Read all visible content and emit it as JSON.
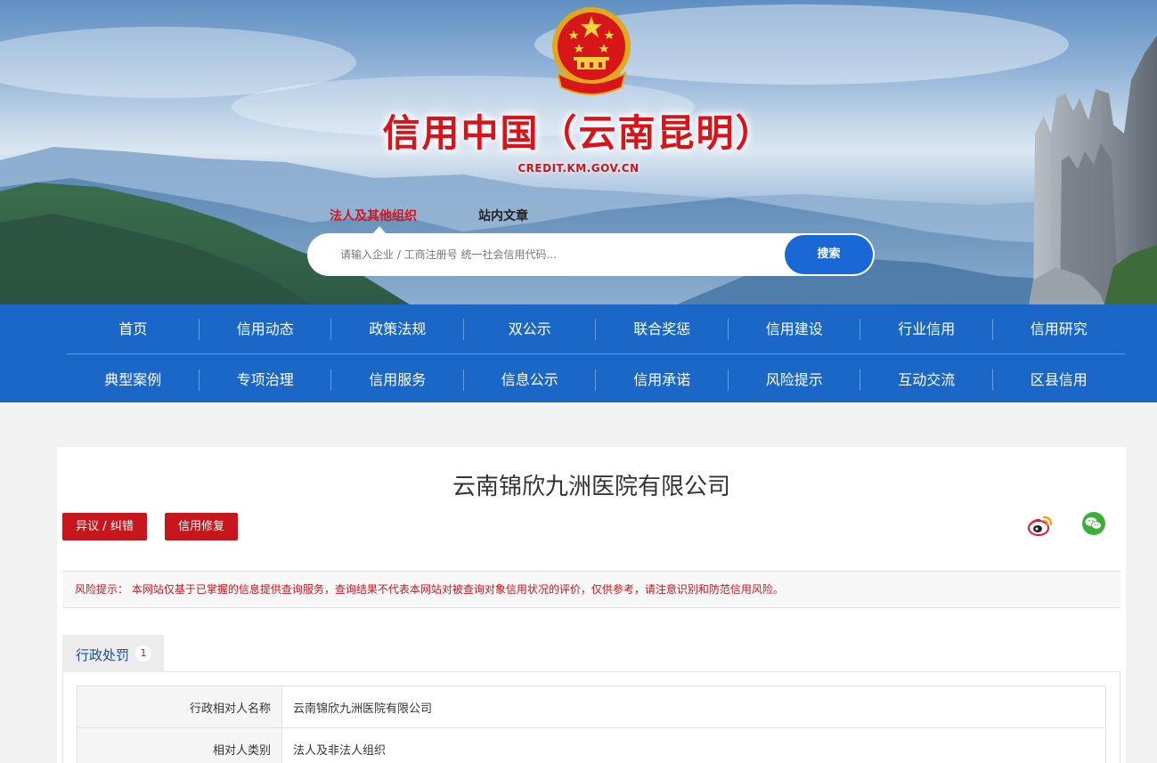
{
  "header": {
    "site_title": "信用中国（云南昆明）",
    "site_domain": "CREDIT.KM.GOV.CN",
    "emblem_icon": "national-emblem-icon"
  },
  "search": {
    "tabs": [
      "法人及其他组织",
      "站内文章"
    ],
    "active_tab": "法人及其他组织",
    "placeholder": "请输入企业 / 工商注册号 统一社会信用代码...",
    "value": "",
    "button_label": "搜索"
  },
  "nav": {
    "row1": [
      "首页",
      "信用动态",
      "政策法规",
      "双公示",
      "联合奖惩",
      "信用建设",
      "行业信用",
      "信用研究"
    ],
    "row2": [
      "典型案例",
      "专项治理",
      "信用服务",
      "信息公示",
      "信用承诺",
      "风险提示",
      "互动交流",
      "区县信用"
    ]
  },
  "company": {
    "name": "云南锦欣九洲医院有限公司"
  },
  "actions": {
    "objection_label": "异议 / 纠错",
    "repair_label": "信用修复",
    "share_icons": [
      "weibo-icon",
      "wechat-icon"
    ]
  },
  "risk_notice": {
    "text": "风险提示： 本网站仅基于已掌握的信息提供查询服务，查询结果不代表本网站对被查询对象信用状况的评价，仅供参考，请注意识别和防范信用风险。"
  },
  "tabs": [
    {
      "label": "行政处罚",
      "count": "1"
    }
  ],
  "detail_rows": [
    {
      "label": "行政相对人名称",
      "value": "云南锦欣九洲医院有限公司"
    },
    {
      "label": "相对人类别",
      "value": "法人及非法人组织"
    }
  ],
  "colors": {
    "brand_red": "#c8161d",
    "nav_blue": "#1a67c8",
    "search_blue": "#1a67d6"
  }
}
